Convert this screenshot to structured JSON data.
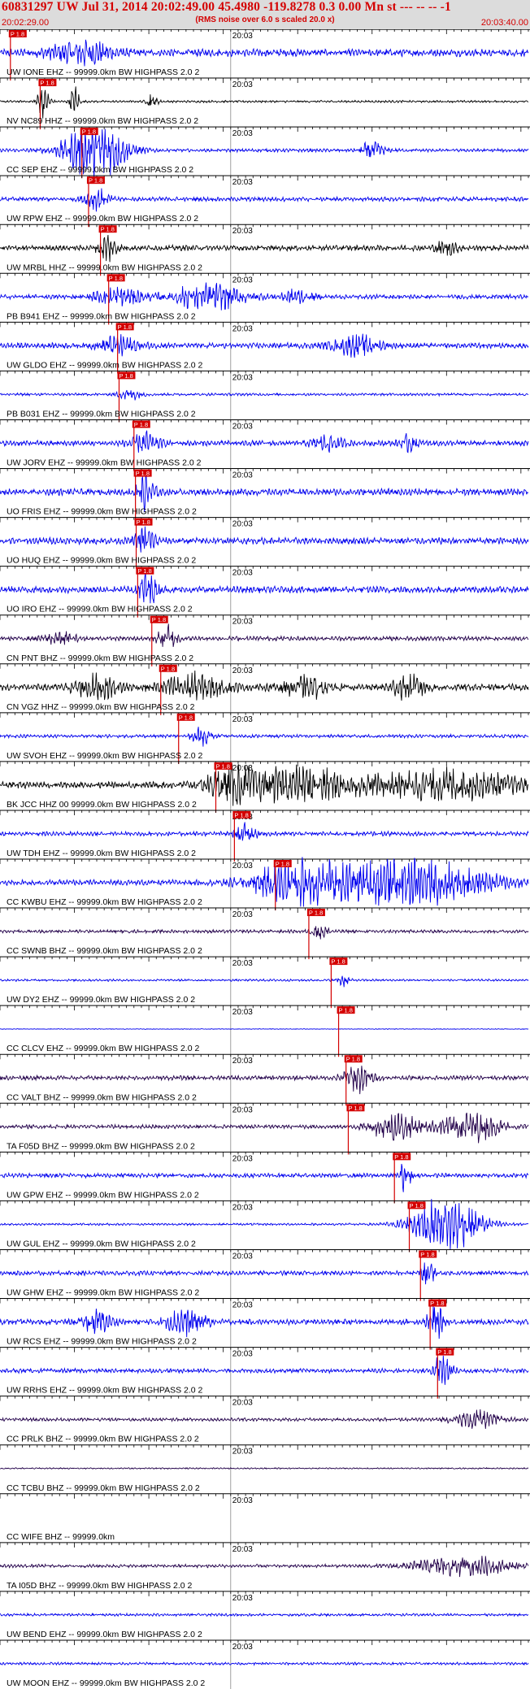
{
  "header": {
    "title": "60831297 UW Jul 31, 2014 20:02:49.00   45.4980 -119.8278  0.3 0.00 Mn st --- -- --  -1",
    "subtitle": "(RMS noise over 6.0 s scaled 20.0 x)",
    "start_time": "20:02:29.00",
    "end_time": "20:03:40.00"
  },
  "colors": {
    "red": "#d40000",
    "blue": "#0000ee",
    "black": "#000000",
    "navy": "#22004a",
    "grid": "#888888"
  },
  "chart_data": {
    "type": "line",
    "xlim_seconds": [
      0,
      71
    ],
    "tick_label": "20:03",
    "pick_label": "P 1.8",
    "traces": [
      {
        "label": "UW IONE EHZ -- 99999.0km BW  HIGHPASS  2.0  2",
        "color": "blue",
        "amp": 0.35,
        "pick": 1.4,
        "bursts": [
          [
            11,
            4,
            1.0
          ]
        ]
      },
      {
        "label": "NV NC89 HHZ -- 99999.0km BW  HIGHPASS  2.0  2",
        "color": "black",
        "amp": 0.1,
        "pick": 5.4,
        "bursts": [
          [
            5.8,
            0.8,
            1.4
          ],
          [
            10,
            0.6,
            1.6
          ],
          [
            20.5,
            0.6,
            1.2
          ]
        ]
      },
      {
        "label": "CC SEP EHZ -- 99999.0km BW  HIGHPASS  2.0  2",
        "color": "blue",
        "amp": 0.15,
        "pick": 11.0,
        "bursts": [
          [
            12.8,
            4,
            2.8
          ],
          [
            50,
            1.5,
            0.8
          ]
        ]
      },
      {
        "label": "UW RPW EHZ -- 99999.0km BW  HIGHPASS  2.0  2",
        "color": "blue",
        "amp": 0.2,
        "pick": 11.9,
        "bursts": [
          [
            13,
            1.5,
            0.9
          ]
        ]
      },
      {
        "label": "UW MRBL HHZ -- 99999.0km BW  HIGHPASS  2.0  2",
        "color": "black",
        "amp": 0.25,
        "pick": 13.5,
        "bursts": [
          [
            14.5,
            1.2,
            1.2
          ],
          [
            60,
            1.5,
            0.6
          ]
        ]
      },
      {
        "label": "PB B941 EHZ -- 99999.0km BW  HIGHPASS  2.0  2",
        "color": "blue",
        "amp": 0.2,
        "pick": 14.6,
        "bursts": [
          [
            16,
            3,
            0.9
          ],
          [
            28,
            5,
            1.2
          ],
          [
            40,
            2,
            0.6
          ]
        ]
      },
      {
        "label": "UW GLDO EHZ -- 99999.0km BW  HIGHPASS  2.0  2",
        "color": "blue",
        "amp": 0.25,
        "pick": 15.8,
        "bursts": [
          [
            16,
            2.5,
            0.9
          ],
          [
            48,
            3,
            0.9
          ]
        ]
      },
      {
        "label": "PB B031 EHZ -- 99999.0km BW  HIGHPASS  2.0  2",
        "color": "blue",
        "amp": 0.12,
        "pick": 16.0,
        "bursts": [
          [
            17.5,
            1.5,
            0.5
          ]
        ]
      },
      {
        "label": "UW JORV EHZ -- 99999.0km BW  HIGHPASS  2.0  2",
        "color": "blue",
        "amp": 0.25,
        "pick": 18.0,
        "bursts": [
          [
            19.5,
            1.8,
            0.9
          ],
          [
            44,
            2,
            0.6
          ],
          [
            55,
            1.2,
            0.7
          ]
        ]
      },
      {
        "label": "UO FRIS EHZ -- 99999.0km BW  HIGHPASS  2.0  2",
        "color": "blue",
        "amp": 0.3,
        "pick": 18.2,
        "bursts": [
          [
            19.5,
            1.2,
            1.5
          ]
        ]
      },
      {
        "label": "UO HUQ EHZ -- 99999.0km BW  HIGHPASS  2.0  2",
        "color": "blue",
        "amp": 0.3,
        "pick": 18.3,
        "bursts": [
          [
            19.6,
            1.2,
            1.5
          ]
        ]
      },
      {
        "label": "UO IRO EHZ -- 99999.0km BW  HIGHPASS  2.0  2",
        "color": "blue",
        "amp": 0.3,
        "pick": 18.5,
        "bursts": [
          [
            19.8,
            1.2,
            1.6
          ]
        ]
      },
      {
        "label": "CN PNT BHZ -- 99999.0km BW  HIGHPASS  2.0  2",
        "color": "navy",
        "amp": 0.2,
        "pick": 20.4,
        "bursts": [
          [
            8,
            2,
            0.6
          ],
          [
            22.5,
            1.2,
            1.3
          ]
        ]
      },
      {
        "label": "CN VGZ HHZ -- 99999.0km BW  HIGHPASS  2.0  2",
        "color": "black",
        "amp": 0.3,
        "pick": 21.6,
        "bursts": [
          [
            13,
            3,
            1.0
          ],
          [
            26,
            4,
            1.2
          ],
          [
            41,
            3,
            1.0
          ],
          [
            55,
            2.5,
            1.0
          ]
        ]
      },
      {
        "label": "UW SVOH EHZ -- 99999.0km BW  HIGHPASS  2.0  2",
        "color": "blue",
        "amp": 0.15,
        "pick": 24.0,
        "bursts": [
          [
            27,
            1.2,
            0.8
          ]
        ]
      },
      {
        "label": "BK JCC HHZ 00 99999.0km BW  HIGHPASS  2.0  2",
        "color": "black",
        "amp": 0.3,
        "pick": 29.0,
        "bursts": [
          [
            31,
            3,
            1.4
          ],
          [
            40,
            8,
            1.5
          ],
          [
            60,
            10,
            1.3
          ]
        ]
      },
      {
        "label": "UW TDH EHZ -- 99999.0km BW  HIGHPASS  2.0  2",
        "color": "blue",
        "amp": 0.2,
        "pick": 31.5,
        "bursts": [
          [
            33,
            1.5,
            0.8
          ]
        ]
      },
      {
        "label": "CC KWBU EHZ -- 99999.0km BW  HIGHPASS  2.0  2",
        "color": "blue",
        "amp": 0.25,
        "pick": 37.0,
        "bursts": [
          [
            40,
            6,
            1.8
          ],
          [
            55,
            10,
            2.2
          ]
        ]
      },
      {
        "label": "CC SWNB BHZ -- 99999.0km BW  HIGHPASS  2.0  2",
        "color": "navy",
        "amp": 0.15,
        "pick": 41.5,
        "bursts": [
          [
            43,
            1.0,
            0.8
          ]
        ]
      },
      {
        "label": "UW DY2 EHZ -- 99999.0km BW  HIGHPASS  2.0  2",
        "color": "blue",
        "amp": 0.1,
        "pick": 44.5,
        "bursts": [
          [
            46,
            0.8,
            0.6
          ]
        ]
      },
      {
        "label": "CC CLCV EHZ -- 99999.0km BW  HIGHPASS  2.0  2",
        "color": "blue",
        "amp": 0.03,
        "pick": 45.5,
        "bursts": []
      },
      {
        "label": "CC VALT BHZ -- 99999.0km BW  HIGHPASS  2.0  2",
        "color": "navy",
        "amp": 0.2,
        "pick": 46.5,
        "bursts": [
          [
            48,
            1.8,
            1.3
          ]
        ]
      },
      {
        "label": "TA F05D BHZ -- 99999.0km BW  HIGHPASS  2.0  2",
        "color": "navy",
        "amp": 0.18,
        "pick": 46.8,
        "bursts": [
          [
            53,
            3,
            1.3
          ],
          [
            63,
            4,
            1.4
          ]
        ]
      },
      {
        "label": "UW GPW EHZ -- 99999.0km BW  HIGHPASS  2.0  2",
        "color": "blue",
        "amp": 0.2,
        "pick": 53.0,
        "bursts": [
          [
            54.5,
            0.8,
            1.5
          ]
        ]
      },
      {
        "label": "UW GUL EHZ -- 99999.0km BW  HIGHPASS  2.0  2",
        "color": "blue",
        "amp": 0.1,
        "pick": 55.0,
        "bursts": [
          [
            60,
            4.5,
            2.5
          ]
        ]
      },
      {
        "label": "UW GHW EHZ -- 99999.0km BW  HIGHPASS  2.0  2",
        "color": "blue",
        "amp": 0.2,
        "pick": 56.5,
        "bursts": [
          [
            57.5,
            1,
            1.2
          ]
        ]
      },
      {
        "label": "UW RCS EHZ -- 99999.0km BW  HIGHPASS  2.0  2",
        "color": "blue",
        "amp": 0.25,
        "pick": 57.8,
        "bursts": [
          [
            13,
            1.8,
            1.1
          ],
          [
            25,
            2.5,
            1.2
          ],
          [
            58.5,
            1,
            1.6
          ]
        ]
      },
      {
        "label": "UW RRHS EHZ -- 99999.0km BW  HIGHPASS  2.0  2",
        "color": "blue",
        "amp": 0.2,
        "pick": 58.8,
        "bursts": [
          [
            59.5,
            1.2,
            1.6
          ]
        ]
      },
      {
        "label": "CC PRLK BHZ -- 99999.0km BW  HIGHPASS  2.0  2",
        "color": "navy",
        "amp": 0.15,
        "pick": null,
        "bursts": [
          [
            64,
            3,
            0.8
          ]
        ]
      },
      {
        "label": "CC TCBU BHZ -- 99999.0km BW  HIGHPASS  2.0  2",
        "color": "navy",
        "amp": 0.06,
        "pick": null,
        "bursts": []
      },
      {
        "label": "CC WIFE BHZ -- 99999.0km",
        "color": "navy",
        "amp": 0.0,
        "pick": null,
        "bursts": []
      },
      {
        "label": "TA I05D BHZ -- 99999.0km BW  HIGHPASS  2.0  2",
        "color": "navy",
        "amp": 0.15,
        "pick": null,
        "bursts": [
          [
            62,
            6,
            1.0
          ]
        ]
      },
      {
        "label": "UW BEND EHZ -- 99999.0km BW  HIGHPASS  2.0  2",
        "color": "blue",
        "amp": 0.12,
        "pick": null,
        "bursts": []
      },
      {
        "label": "UW MOON EHZ -- 99999.0km BW  HIGHPASS  2.0  2",
        "color": "blue",
        "amp": 0.12,
        "pick": null,
        "bursts": []
      }
    ]
  }
}
